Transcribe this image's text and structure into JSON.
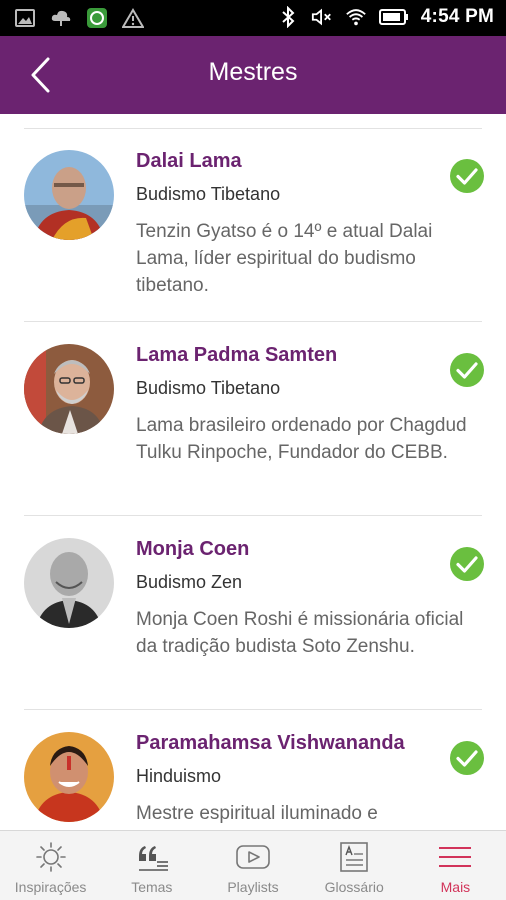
{
  "status_bar": {
    "time": "4:54 PM",
    "icons_left": [
      "image-icon",
      "cloud-icon",
      "app-notification-icon",
      "warning-icon"
    ],
    "icons_right": [
      "bluetooth-icon",
      "mute-icon",
      "wifi-icon",
      "battery-icon"
    ]
  },
  "header": {
    "title": "Mestres",
    "back_icon": "back-arrow-icon",
    "background": "#6b2370"
  },
  "masters": [
    {
      "name": "Dalai Lama",
      "tradition": "Budismo Tibetano",
      "description": "Tenzin Gyatso é o 14º e atual Dalai Lama, líder espiritual do budismo tibetano.",
      "checked": true
    },
    {
      "name": "Lama Padma Samten",
      "tradition": "Budismo Tibetano",
      "description": "Lama brasileiro ordenado por Chagdud Tulku Rinpoche, Fundador do CEBB.",
      "checked": true
    },
    {
      "name": "Monja Coen",
      "tradition": "Budismo Zen",
      "description": "Monja Coen Roshi é missionária oficial da tradição budista Soto Zenshu.",
      "checked": true
    },
    {
      "name": "Paramahamsa Vishwananda",
      "tradition": "Hinduismo",
      "description": "Mestre espiritual iluminado e",
      "checked": true
    }
  ],
  "bottom_nav": [
    {
      "label": "Inspirações",
      "icon": "sun-icon",
      "active": false
    },
    {
      "label": "Temas",
      "icon": "quote-icon",
      "active": false
    },
    {
      "label": "Playlists",
      "icon": "play-icon",
      "active": false
    },
    {
      "label": "Glossário",
      "icon": "glossary-icon",
      "active": false
    },
    {
      "label": "Mais",
      "icon": "menu-icon",
      "active": true
    }
  ],
  "colors": {
    "accent": "#6b2370",
    "check_green": "#6abf3f",
    "active_tab": "#d2335a"
  }
}
